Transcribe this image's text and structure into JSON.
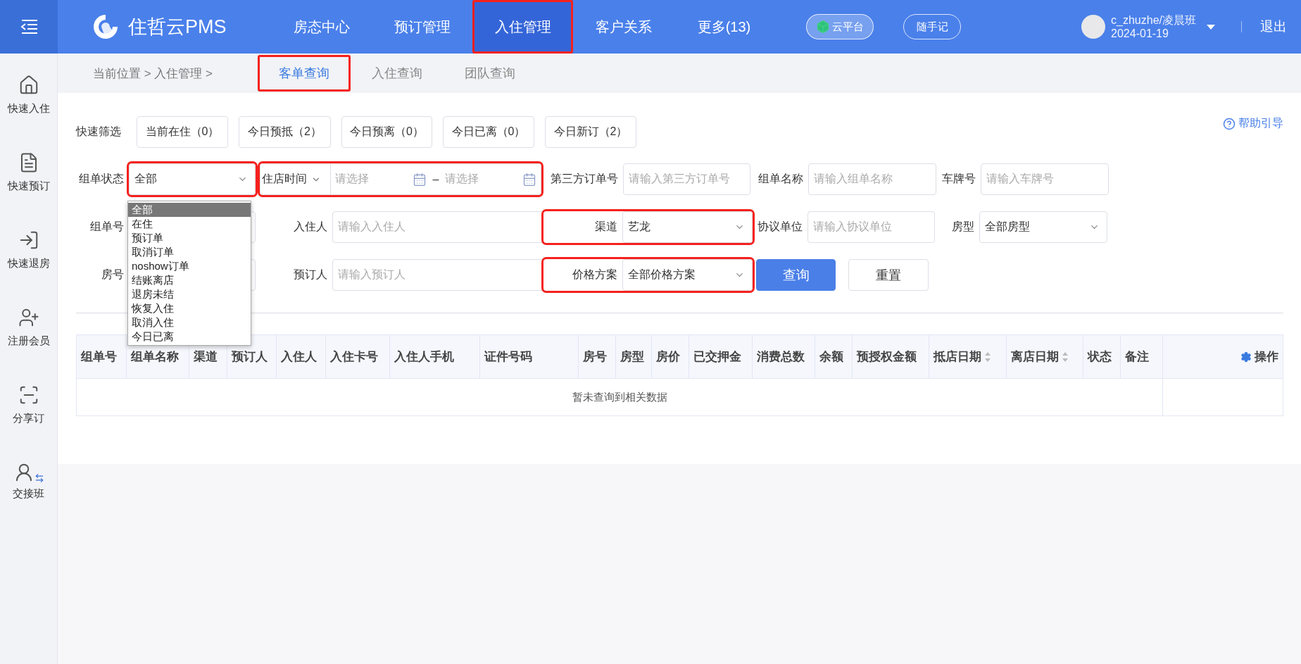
{
  "nav": {
    "logo": "住哲云PMS",
    "items": [
      {
        "label": "房态中心",
        "selected": false,
        "highlighted": false
      },
      {
        "label": "预订管理",
        "selected": false,
        "highlighted": false
      },
      {
        "label": "入住管理",
        "selected": true,
        "highlighted": true
      },
      {
        "label": "客户关系",
        "selected": false,
        "highlighted": false
      },
      {
        "label": "更多(13)",
        "selected": false,
        "highlighted": false
      }
    ],
    "cloud_button": "云平台",
    "note_button": "随手记",
    "user": {
      "name": "c_zhuzhe/凌晨班",
      "date": "2024-01-19"
    },
    "logout": "退出"
  },
  "sidebar": {
    "items": [
      {
        "label": "快速入住",
        "kind": "checkin"
      },
      {
        "label": "快速预订",
        "kind": "booking"
      },
      {
        "label": "快速退房",
        "kind": "checkout"
      },
      {
        "label": "注册会员",
        "kind": "member"
      },
      {
        "label": "分享订",
        "kind": "share"
      },
      {
        "label": "交接班",
        "kind": "shift"
      }
    ]
  },
  "breadcrumb": "当前位置 > 入住管理 >",
  "tabs": [
    {
      "label": "客单查询",
      "selected": true,
      "highlighted": true
    },
    {
      "label": "入住查询",
      "selected": false,
      "highlighted": false
    },
    {
      "label": "团队查询",
      "selected": false,
      "highlighted": false
    }
  ],
  "quick_filter": {
    "label": "快速筛选",
    "buttons": [
      "当前在住（0）",
      "今日预抵（2）",
      "今日预离（0）",
      "今日已离（0）",
      "今日新订（2）"
    ]
  },
  "help_link": "帮助引导",
  "form_rows": [
    [
      {
        "kind": "select",
        "label": "组单状态",
        "value": "全部",
        "highlighted": true
      },
      {
        "kind": "date_range",
        "select": "住店时间",
        "start_placeholder": "请选择",
        "separator": "–",
        "end_placeholder": "请选择",
        "highlighted": true
      },
      {
        "kind": "input",
        "label": "第三方订单号",
        "placeholder": "请输入第三方订单号"
      },
      {
        "kind": "input",
        "label": "组单名称",
        "placeholder": "请输入组单名称"
      },
      {
        "kind": "input",
        "label": "车牌号",
        "placeholder": "请输入车牌号"
      }
    ],
    [
      {
        "kind": "input",
        "label": "组单号"
      },
      {
        "kind": "input",
        "label": "入住人",
        "placeholder": "请输入入住人"
      },
      {
        "kind": "select",
        "label": "渠道",
        "value": "艺龙",
        "highlighted": true
      },
      {
        "kind": "input",
        "label": "协议单位",
        "placeholder": "请输入协议单位"
      },
      {
        "kind": "select",
        "label": "房型",
        "value": "全部房型"
      }
    ],
    [
      {
        "kind": "input",
        "label": "房号"
      },
      {
        "kind": "input",
        "label": "预订人",
        "placeholder": "请输入预订人"
      },
      {
        "kind": "select",
        "label": "价格方案",
        "value": "全部价格方案",
        "highlighted": true
      },
      {
        "kind": "button",
        "label": "查询",
        "primary": true
      },
      {
        "kind": "button",
        "label": "重置",
        "primary": false
      }
    ]
  ],
  "status_dropdown": [
    {
      "label": "全部",
      "selected": true
    },
    {
      "label": "在住",
      "selected": false
    },
    {
      "label": "预订单",
      "selected": false
    },
    {
      "label": "取消订单",
      "selected": false
    },
    {
      "label": "noshow订单",
      "selected": false
    },
    {
      "label": "结账离店",
      "selected": false
    },
    {
      "label": "退房未结",
      "selected": false
    },
    {
      "label": "恢复入住",
      "selected": false
    },
    {
      "label": "取消入住",
      "selected": false
    },
    {
      "label": "今日已离",
      "selected": false
    }
  ],
  "table": {
    "columns": [
      {
        "label": "组单号",
        "sortable": false
      },
      {
        "label": "组单名称",
        "sortable": false
      },
      {
        "label": "渠道",
        "sortable": false
      },
      {
        "label": "预订人",
        "sortable": false
      },
      {
        "label": "入住人",
        "sortable": false
      },
      {
        "label": "入住卡号",
        "sortable": false
      },
      {
        "label": "入住人手机",
        "sortable": false
      },
      {
        "label": "证件号码",
        "sortable": false
      },
      {
        "label": "房号",
        "sortable": false
      },
      {
        "label": "房型",
        "sortable": false
      },
      {
        "label": "房价",
        "sortable": false
      },
      {
        "label": "已交押金",
        "sortable": false
      },
      {
        "label": "消费总数",
        "sortable": false
      },
      {
        "label": "余额",
        "sortable": false
      },
      {
        "label": "预授权金额",
        "sortable": false
      },
      {
        "label": "抵店日期",
        "sortable": true
      },
      {
        "label": "离店日期",
        "sortable": true
      },
      {
        "label": "状态",
        "sortable": false
      },
      {
        "label": "备注",
        "sortable": false
      },
      {
        "label": "操作",
        "sortable": false,
        "kind": "actions"
      }
    ],
    "empty_text": "暂未查询到相关数据"
  }
}
